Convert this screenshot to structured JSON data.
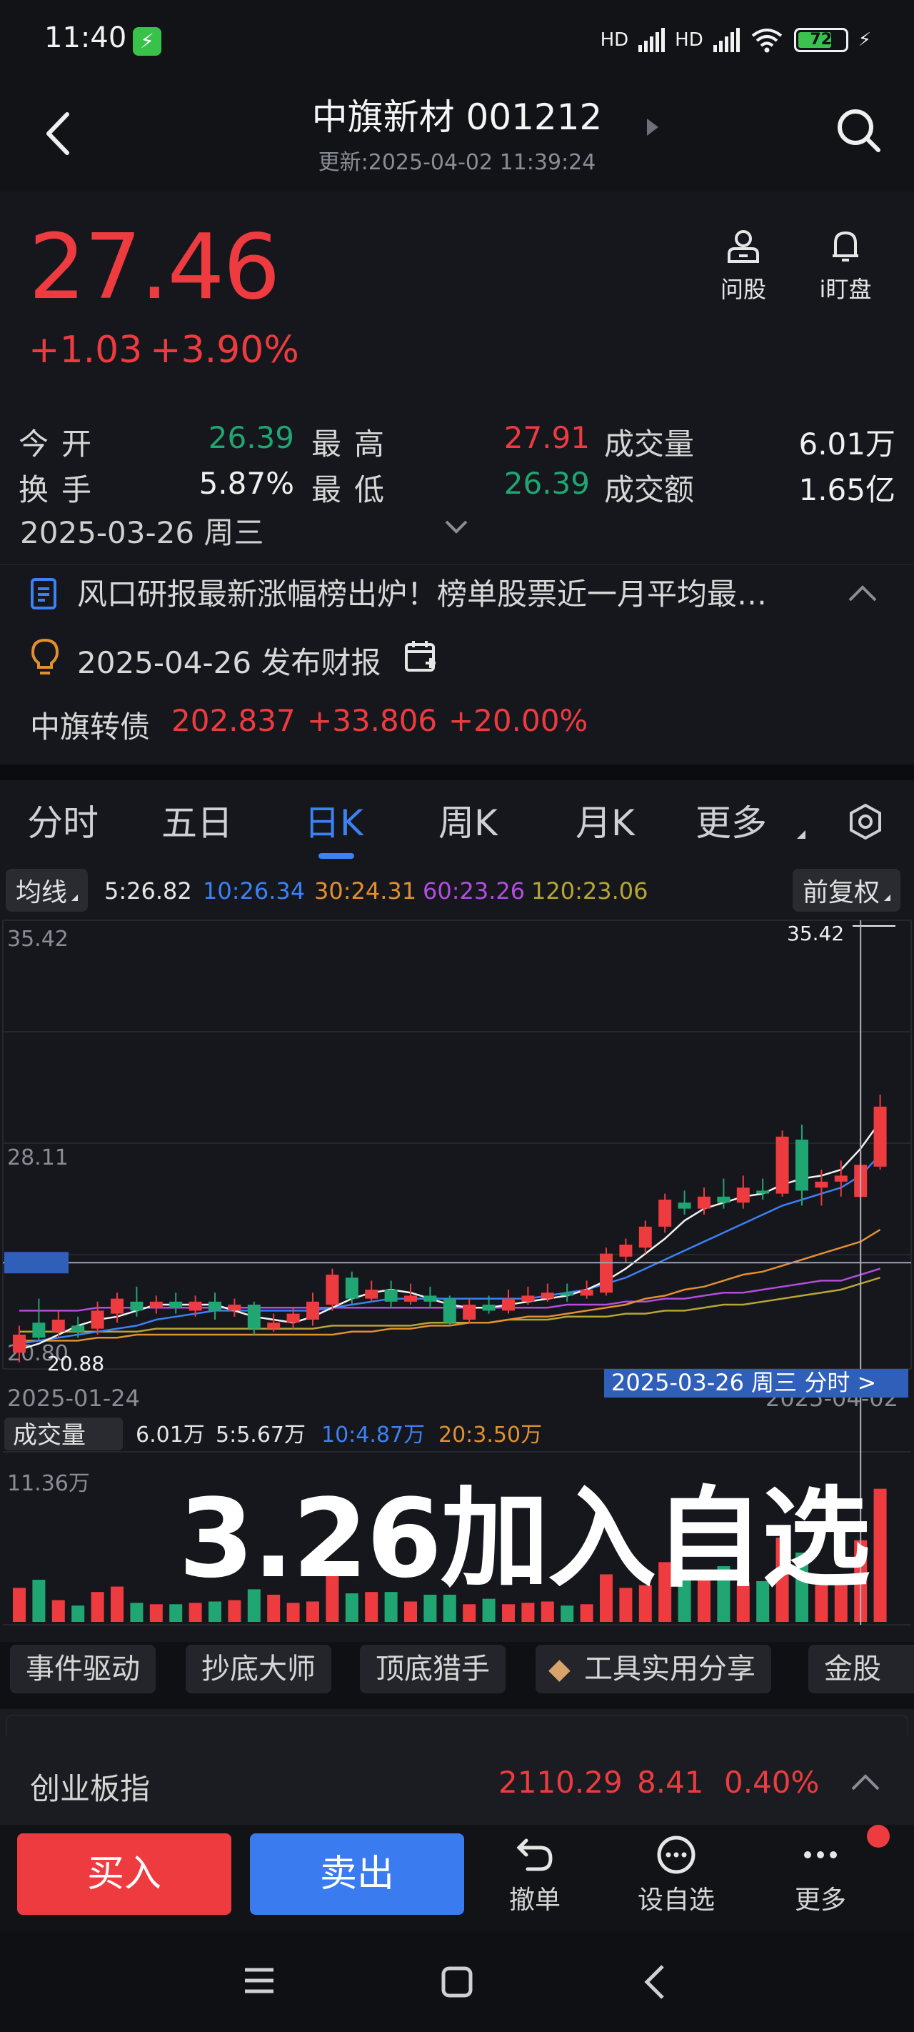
{
  "status_bar": {
    "time": "11:40",
    "network_1": "HD",
    "network_2": "HD",
    "battery_level": "72",
    "battery_fraction": 0.72
  },
  "header": {
    "title": "中旗新材 001212",
    "update_time": "更新:2025-04-02 11:39:24"
  },
  "quote": {
    "price": "27.46",
    "change": "+1.03",
    "change_pct": "+3.90%",
    "quick_actions": [
      {
        "label": "问股",
        "icon": "person-icon"
      },
      {
        "label": "i盯盘",
        "icon": "bell-icon"
      }
    ],
    "stats": {
      "open_label": "今开",
      "open_value": "26.39",
      "high_label": "最高",
      "high_value": "27.91",
      "volume_label": "成交量",
      "volume_value": "6.01万",
      "turnover_label": "换手",
      "turnover_value": "5.87%",
      "low_label": "最低",
      "low_value": "26.39",
      "amount_label": "成交额",
      "amount_value": "1.65亿"
    },
    "date": "2025-03-26 周三",
    "news": "风口研报最新涨幅榜出炉！榜单股票近一月平均最…",
    "report": "2025-04-26 发布财报",
    "bond": {
      "name": "中旗转债",
      "price": "202.837",
      "change": "+33.806",
      "pct": "+20.00%"
    }
  },
  "tabs": {
    "items": [
      "分时",
      "五日",
      "日K",
      "周K",
      "月K",
      "更多"
    ],
    "active": "日K"
  },
  "ma_bar": {
    "chip": "均线",
    "adjust": "前复权",
    "ma5": "5:26.82",
    "ma10": "10:26.34",
    "ma30": "30:24.31",
    "ma60": "60:23.26",
    "ma120": "120:23.06"
  },
  "kline": {
    "y_top": "35.42",
    "y_mid": "28.11",
    "y_low": "20.80",
    "min_mark": "20.88",
    "max_mark": "35.42",
    "date_start": "2025-01-24",
    "date_end": "2025-04-02",
    "crosshair_label": "2025-03-26 周三 分时 >"
  },
  "volume_bar": {
    "chip": "成交量",
    "v": "6.01万",
    "v5": "5:5.67万",
    "v10": "10:4.87万",
    "v20": "20:3.50万",
    "max": "11.36万"
  },
  "overlay_text": "3.26加入自选",
  "feature_chips": [
    "事件驱动",
    "抄底大师",
    "顶底猎手",
    "工具实用分享",
    "金股雷"
  ],
  "index": {
    "name": "创业板指",
    "value": "2110.29",
    "change": "8.41",
    "pct": "0.40%"
  },
  "trade_bar": {
    "buy": "买入",
    "sell": "卖出",
    "tools": [
      {
        "label": "撤单",
        "icon": "undo-icon"
      },
      {
        "label": "设自选",
        "icon": "more-circle-icon"
      },
      {
        "label": "更多",
        "icon": "ellipsis-icon"
      }
    ]
  },
  "colors": {
    "up": "#ee3b40",
    "down": "#1fa672",
    "accent": "#3b82f6",
    "background": "#16171c",
    "ma5": "#f2f2f2",
    "ma10": "#3b82f6",
    "ma30": "#e2902f",
    "ma60": "#b24de0",
    "ma120": "#b7a634"
  },
  "chart_data": {
    "type": "candlestick",
    "title": "",
    "x_start": "2025-01-24",
    "x_end": "2025-04-02",
    "ylim": [
      20.8,
      35.42
    ],
    "candles": [
      {
        "o": 21.2,
        "c": 21.8,
        "h": 22.1,
        "l": 20.88
      },
      {
        "o": 22.2,
        "c": 21.7,
        "h": 23.0,
        "l": 21.6
      },
      {
        "o": 21.9,
        "c": 22.3,
        "h": 22.6,
        "l": 21.7
      },
      {
        "o": 22.1,
        "c": 21.9,
        "h": 22.4,
        "l": 21.7
      },
      {
        "o": 22.0,
        "c": 22.6,
        "h": 22.9,
        "l": 21.8
      },
      {
        "o": 22.5,
        "c": 23.0,
        "h": 23.2,
        "l": 22.2
      },
      {
        "o": 22.9,
        "c": 22.6,
        "h": 23.4,
        "l": 22.4
      },
      {
        "o": 22.7,
        "c": 22.9,
        "h": 23.1,
        "l": 22.5
      },
      {
        "o": 22.9,
        "c": 22.7,
        "h": 23.2,
        "l": 22.5
      },
      {
        "o": 22.6,
        "c": 22.9,
        "h": 23.1,
        "l": 22.4
      },
      {
        "o": 22.9,
        "c": 22.6,
        "h": 23.2,
        "l": 22.3
      },
      {
        "o": 22.6,
        "c": 22.8,
        "h": 23.0,
        "l": 22.4
      },
      {
        "o": 22.8,
        "c": 22.0,
        "h": 22.9,
        "l": 21.8
      },
      {
        "o": 22.0,
        "c": 22.2,
        "h": 22.5,
        "l": 21.9
      },
      {
        "o": 22.2,
        "c": 22.5,
        "h": 22.7,
        "l": 22.0
      },
      {
        "o": 22.3,
        "c": 22.9,
        "h": 23.2,
        "l": 22.1
      },
      {
        "o": 22.8,
        "c": 23.8,
        "h": 24.0,
        "l": 22.6
      },
      {
        "o": 23.7,
        "c": 23.0,
        "h": 23.9,
        "l": 22.8
      },
      {
        "o": 23.0,
        "c": 23.3,
        "h": 23.6,
        "l": 22.9
      },
      {
        "o": 23.3,
        "c": 22.9,
        "h": 23.6,
        "l": 22.7
      },
      {
        "o": 22.9,
        "c": 23.1,
        "h": 23.5,
        "l": 22.8
      },
      {
        "o": 23.1,
        "c": 22.9,
        "h": 23.4,
        "l": 22.7
      },
      {
        "o": 23.0,
        "c": 22.2,
        "h": 23.1,
        "l": 22.1
      },
      {
        "o": 22.3,
        "c": 22.8,
        "h": 23.0,
        "l": 22.2
      },
      {
        "o": 22.8,
        "c": 22.6,
        "h": 23.1,
        "l": 22.5
      },
      {
        "o": 22.6,
        "c": 23.0,
        "h": 23.3,
        "l": 22.5
      },
      {
        "o": 22.9,
        "c": 23.1,
        "h": 23.4,
        "l": 22.8
      },
      {
        "o": 23.0,
        "c": 23.2,
        "h": 23.5,
        "l": 22.9
      },
      {
        "o": 23.2,
        "c": 23.1,
        "h": 23.5,
        "l": 22.9
      },
      {
        "o": 23.1,
        "c": 23.3,
        "h": 23.6,
        "l": 23.0
      },
      {
        "o": 23.2,
        "c": 24.5,
        "h": 24.7,
        "l": 23.1
      },
      {
        "o": 24.4,
        "c": 24.8,
        "h": 25.0,
        "l": 24.2
      },
      {
        "o": 24.7,
        "c": 25.4,
        "h": 25.6,
        "l": 24.5
      },
      {
        "o": 25.4,
        "c": 26.3,
        "h": 26.5,
        "l": 25.2
      },
      {
        "o": 26.2,
        "c": 26.0,
        "h": 26.6,
        "l": 25.8
      },
      {
        "o": 26.0,
        "c": 26.4,
        "h": 26.7,
        "l": 25.8
      },
      {
        "o": 26.4,
        "c": 26.2,
        "h": 27.0,
        "l": 26.0
      },
      {
        "o": 26.2,
        "c": 26.7,
        "h": 27.1,
        "l": 26.0
      },
      {
        "o": 26.6,
        "c": 26.5,
        "h": 27.0,
        "l": 26.3
      },
      {
        "o": 26.5,
        "c": 28.4,
        "h": 28.6,
        "l": 26.4
      },
      {
        "o": 28.3,
        "c": 26.6,
        "h": 28.8,
        "l": 26.1
      },
      {
        "o": 26.7,
        "c": 26.9,
        "h": 27.3,
        "l": 26.1
      },
      {
        "o": 26.9,
        "c": 27.1,
        "h": 27.6,
        "l": 26.4
      },
      {
        "o": 26.39,
        "c": 27.46,
        "h": 27.91,
        "l": 26.39
      },
      {
        "o": 27.4,
        "c": 29.4,
        "h": 29.8,
        "l": 27.3
      }
    ],
    "volumes": [
      2.5,
      3.1,
      1.6,
      1.2,
      2.2,
      2.6,
      1.4,
      1.3,
      1.3,
      1.4,
      1.5,
      1.6,
      2.4,
      2.0,
      1.4,
      1.5,
      4.3,
      2.1,
      2.2,
      2.2,
      1.5,
      2.0,
      2.0,
      1.3,
      1.7,
      1.3,
      1.4,
      1.5,
      1.2,
      1.3,
      3.5,
      2.5,
      2.7,
      4.4,
      3.1,
      3.7,
      4.1,
      2.9,
      3.0,
      6.2,
      5.1,
      2.7,
      3.4,
      6.01,
      9.8
    ],
    "vol_ylim": [
      0,
      11.36
    ],
    "ma5": [
      21.3,
      21.5,
      21.8,
      22.1,
      22.3,
      22.4,
      22.6,
      22.8,
      22.8,
      22.8,
      22.8,
      22.6,
      22.4,
      22.3,
      22.2,
      22.4,
      22.7,
      23.0,
      23.2,
      23.3,
      23.2,
      23.0,
      22.8,
      22.7,
      22.7,
      22.8,
      22.9,
      23.0,
      23.1,
      23.3,
      23.6,
      24.0,
      24.5,
      25.0,
      25.6,
      26.0,
      26.2,
      26.4,
      26.5,
      26.8,
      27.0,
      27.1,
      27.3,
      28.0,
      28.9
    ],
    "ma10": [
      21.5,
      21.6,
      21.7,
      21.8,
      21.9,
      22.0,
      22.1,
      22.3,
      22.4,
      22.5,
      22.6,
      22.6,
      22.6,
      22.6,
      22.6,
      22.6,
      22.7,
      22.8,
      22.9,
      23.0,
      23.0,
      23.0,
      23.0,
      23.0,
      23.0,
      23.0,
      23.0,
      23.1,
      23.2,
      23.3,
      23.5,
      23.7,
      24.0,
      24.3,
      24.6,
      24.9,
      25.2,
      25.5,
      25.8,
      26.1,
      26.3,
      26.5,
      26.7,
      27.1,
      27.8
    ],
    "ma30": [
      21.6,
      21.6,
      21.6,
      21.6,
      21.7,
      21.7,
      21.8,
      21.8,
      21.8,
      21.8,
      21.8,
      21.8,
      21.8,
      21.8,
      21.8,
      21.8,
      21.8,
      21.9,
      21.9,
      22.0,
      22.0,
      22.1,
      22.1,
      22.2,
      22.2,
      22.3,
      22.4,
      22.4,
      22.5,
      22.6,
      22.7,
      22.8,
      23.0,
      23.1,
      23.3,
      23.4,
      23.6,
      23.8,
      23.9,
      24.1,
      24.3,
      24.5,
      24.7,
      24.9,
      25.3
    ],
    "ma60": [
      22.6,
      22.6,
      22.6,
      22.6,
      22.7,
      22.7,
      22.7,
      22.7,
      22.7,
      22.7,
      22.7,
      22.7,
      22.7,
      22.7,
      22.7,
      22.7,
      22.7,
      22.7,
      22.7,
      22.7,
      22.7,
      22.7,
      22.7,
      22.7,
      22.7,
      22.7,
      22.7,
      22.7,
      22.8,
      22.8,
      22.8,
      22.9,
      22.9,
      23.0,
      23.0,
      23.1,
      23.2,
      23.2,
      23.3,
      23.4,
      23.5,
      23.6,
      23.6,
      23.8,
      24.0
    ],
    "ma120": [
      21.9,
      21.9,
      21.9,
      21.9,
      21.9,
      21.9,
      21.9,
      22.0,
      22.0,
      22.0,
      22.0,
      22.0,
      22.0,
      22.0,
      22.0,
      22.0,
      22.1,
      22.1,
      22.1,
      22.1,
      22.1,
      22.2,
      22.2,
      22.2,
      22.2,
      22.3,
      22.3,
      22.3,
      22.4,
      22.4,
      22.4,
      22.5,
      22.5,
      22.6,
      22.6,
      22.7,
      22.8,
      22.8,
      22.9,
      23.0,
      23.1,
      23.2,
      23.3,
      23.5,
      23.7
    ],
    "crosshair_index": 43,
    "support_price": 24.2
  }
}
